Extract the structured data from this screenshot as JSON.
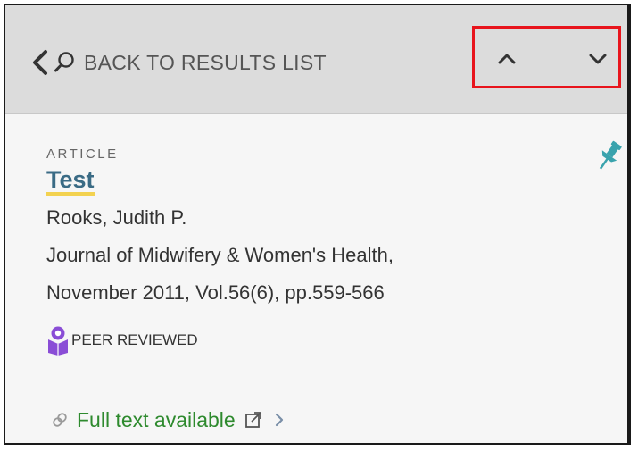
{
  "nav": {
    "back_label": "BACK TO RESULTS LIST",
    "icons": [
      "chevron-left-icon",
      "search-icon",
      "chevron-up-icon",
      "chevron-down-icon"
    ]
  },
  "record": {
    "type": "ARTICLE",
    "title": "Test",
    "author": "Rooks, Judith P.",
    "source_line1": "Journal of Midwifery & Women's Health,",
    "source_line2": "November 2011, Vol.56(6), pp.559-566",
    "peer_reviewed": "PEER REVIEWED",
    "availability": "Full text available"
  },
  "colors": {
    "title": "#3a6b85",
    "title_underline": "#f3d250",
    "highlight_box": "#e8141c",
    "pin": "#3aa3ad",
    "peer_icon": "#8a4dd6",
    "availability": "#2e8a2e"
  }
}
